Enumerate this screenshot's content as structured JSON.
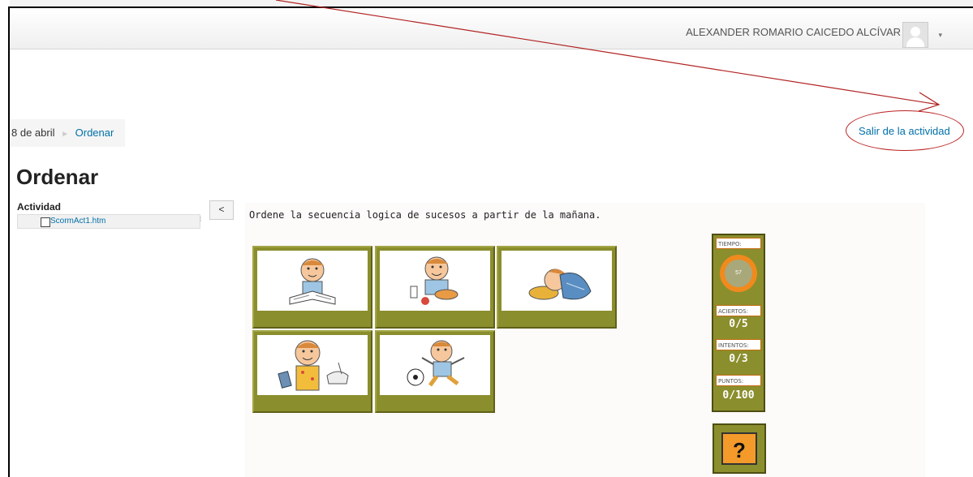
{
  "header": {
    "user_name": "ALEXANDER ROMARIO CAICEDO ALCÍVAR",
    "caret": "▾"
  },
  "breadcrumb": {
    "items": [
      "8 de abril",
      "Ordenar"
    ],
    "separator": "►"
  },
  "exit_link": "Salir de la actividad",
  "page_title": "Ordenar",
  "toc": {
    "title": "Actividad",
    "items": [
      "ScormAct1.htm"
    ],
    "collapse_label": "<"
  },
  "activity": {
    "instruction": "Ordene la secuencia logica de sucesos a partir de la mañana.",
    "cards": [
      "boy-reading-book",
      "boy-eating-breakfast",
      "boy-sleeping",
      "boy-brushing-teeth",
      "boy-playing-soccer"
    ]
  },
  "score_panel": {
    "time_label": "TIEMPO:",
    "time_value": "57",
    "hits_label": "ACIERTOS:",
    "hits_value": "0/5",
    "attempts_label": "INTENTOS:",
    "attempts_value": "0/3",
    "points_label": "PUNTOS:",
    "points_value": "0/100"
  },
  "help_button": "?",
  "colors": {
    "panel_olive": "#8b8e2d",
    "timer_orange": "#f08a1d",
    "link_blue": "#0070a8",
    "annotation_red": "#b22222"
  }
}
